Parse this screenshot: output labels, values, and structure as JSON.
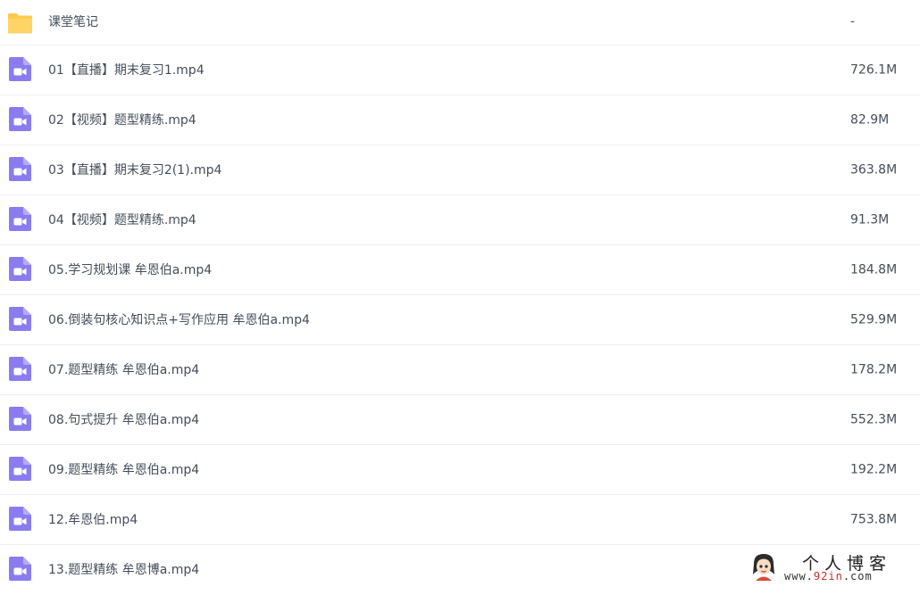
{
  "colors": {
    "folder": "#ffc94d",
    "video_icon": "#8a7cf0",
    "text": "#454d5a",
    "row_divider": "#eceef2",
    "watermark_red": "#d42a2a"
  },
  "files": [
    {
      "name": "课堂笔记",
      "size": "-",
      "icon": "folder-icon"
    },
    {
      "name": "01【直播】期末复习1.mp4",
      "size": "726.1M",
      "icon": "video-file-icon"
    },
    {
      "name": "02【视频】题型精练.mp4",
      "size": "82.9M",
      "icon": "video-file-icon"
    },
    {
      "name": "03【直播】期末复习2(1).mp4",
      "size": "363.8M",
      "icon": "video-file-icon"
    },
    {
      "name": "04【视频】题型精练.mp4",
      "size": "91.3M",
      "icon": "video-file-icon"
    },
    {
      "name": "05.学习规划课 牟恩伯a.mp4",
      "size": "184.8M",
      "icon": "video-file-icon"
    },
    {
      "name": "06.倒装句核心知识点+写作应用 牟恩伯a.mp4",
      "size": "529.9M",
      "icon": "video-file-icon"
    },
    {
      "name": "07.题型精练 牟恩伯a.mp4",
      "size": "178.2M",
      "icon": "video-file-icon"
    },
    {
      "name": "08.句式提升 牟恩伯a.mp4",
      "size": "552.3M",
      "icon": "video-file-icon"
    },
    {
      "name": "09.题型精练 牟恩伯a.mp4",
      "size": "192.2M",
      "icon": "video-file-icon"
    },
    {
      "name": "12.牟恩伯.mp4",
      "size": "753.8M",
      "icon": "video-file-icon"
    },
    {
      "name": "13.题型精练 牟恩博a.mp4",
      "size": "",
      "icon": "video-file-icon"
    }
  ],
  "watermark": {
    "title": "个人博客",
    "url_prefix": "www.",
    "url_highlight": "92in",
    "url_suffix": ".com"
  }
}
